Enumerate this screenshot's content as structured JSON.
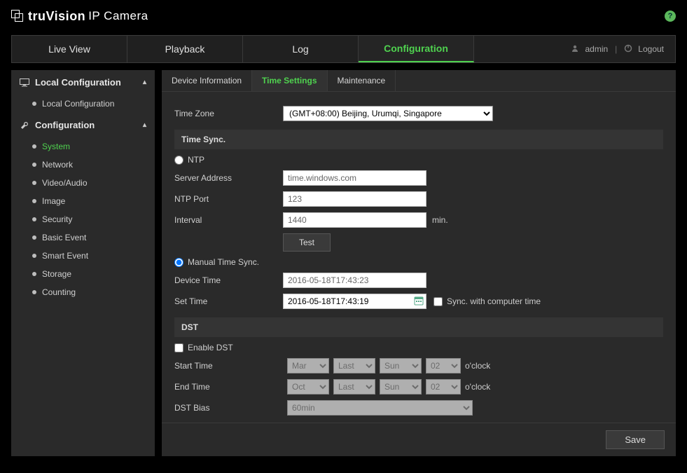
{
  "brand": {
    "name": "truVision",
    "sub": "IP Camera"
  },
  "help_icon": "?",
  "nav": {
    "tabs": [
      "Live View",
      "Playback",
      "Log",
      "Configuration"
    ],
    "active": 3,
    "user": "admin",
    "logout": "Logout"
  },
  "sidebar": {
    "sections": [
      {
        "title": "Local Configuration",
        "icon": "monitor-icon",
        "items": [
          "Local Configuration"
        ],
        "active_index": -1
      },
      {
        "title": "Configuration",
        "icon": "wrench-icon",
        "items": [
          "System",
          "Network",
          "Video/Audio",
          "Image",
          "Security",
          "Basic Event",
          "Smart Event",
          "Storage",
          "Counting"
        ],
        "active_index": 0
      }
    ]
  },
  "subtabs": {
    "items": [
      "Device Information",
      "Time Settings",
      "Maintenance"
    ],
    "active": 1
  },
  "form": {
    "timezone_label": "Time Zone",
    "timezone_value": "(GMT+08:00) Beijing, Urumqi, Singapore",
    "timesync_header": "Time Sync.",
    "ntp_label": "NTP",
    "ntp_selected": false,
    "server_address_label": "Server Address",
    "server_address_value": "time.windows.com",
    "ntp_port_label": "NTP Port",
    "ntp_port_value": "123",
    "interval_label": "Interval",
    "interval_value": "1440",
    "interval_unit": "min.",
    "test_btn": "Test",
    "manual_label": "Manual Time Sync.",
    "manual_selected": true,
    "device_time_label": "Device Time",
    "device_time_value": "2016-05-18T17:43:23",
    "set_time_label": "Set Time",
    "set_time_value": "2016-05-18T17:43:19",
    "sync_computer_label": "Sync. with computer time",
    "sync_computer_checked": false,
    "dst_header": "DST",
    "enable_dst_label": "Enable DST",
    "enable_dst_checked": false,
    "start_time_label": "Start Time",
    "start": {
      "month": "Mar",
      "week": "Last",
      "day": "Sun",
      "hour": "02"
    },
    "end_time_label": "End Time",
    "end": {
      "month": "Oct",
      "week": "Last",
      "day": "Sun",
      "hour": "02"
    },
    "oclock": "o'clock",
    "dst_bias_label": "DST Bias",
    "dst_bias_value": "60min",
    "save_btn": "Save"
  }
}
